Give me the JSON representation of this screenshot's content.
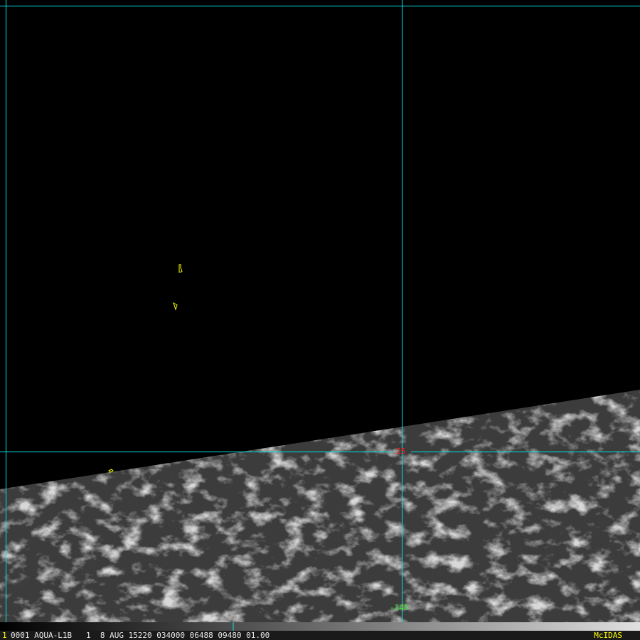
{
  "image": {
    "frame_number": "1",
    "info_line": "0001 AQUA-L1B   1  8 AUG 15220 034000 06488 09480 01.00",
    "brand": "McIDAS",
    "lat_label": "25",
    "lon_label": "-145",
    "colors": {
      "grid": "#00e5e5",
      "lat_label": "#ff2020",
      "lon_label": "#20ff20",
      "map": "#ffff00"
    }
  }
}
